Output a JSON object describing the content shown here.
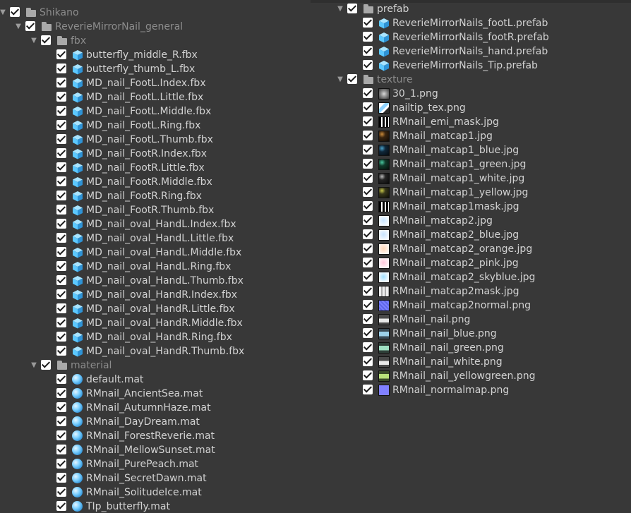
{
  "colors": {
    "background": "#383838",
    "text": "#d2d2d2",
    "dim_text": "#8c8c8c",
    "checkbox": "#ffffff",
    "cube_icon": "#5cc8ff",
    "material_icon": "#56b9f2"
  },
  "left_tree": [
    {
      "label": "Shikano",
      "level": 0,
      "kind": "folder",
      "arrow": true,
      "dim": true
    },
    {
      "label": "ReverieMirrorNail_general",
      "level": 1,
      "kind": "folder",
      "arrow": true,
      "dim": true
    },
    {
      "label": "fbx",
      "level": 2,
      "kind": "folder",
      "arrow": true,
      "dim": true
    },
    {
      "label": "butterfly_middle_R.fbx",
      "level": 3,
      "kind": "fbx"
    },
    {
      "label": "butterfly_thumb_L.fbx",
      "level": 3,
      "kind": "fbx"
    },
    {
      "label": "MD_nail_FootL.Index.fbx",
      "level": 3,
      "kind": "fbx"
    },
    {
      "label": "MD_nail_FootL.Little.fbx",
      "level": 3,
      "kind": "fbx"
    },
    {
      "label": "MD_nail_FootL.Middle.fbx",
      "level": 3,
      "kind": "fbx"
    },
    {
      "label": "MD_nail_FootL.Ring.fbx",
      "level": 3,
      "kind": "fbx"
    },
    {
      "label": "MD_nail_FootL.Thumb.fbx",
      "level": 3,
      "kind": "fbx"
    },
    {
      "label": "MD_nail_FootR.Index.fbx",
      "level": 3,
      "kind": "fbx"
    },
    {
      "label": "MD_nail_FootR.Little.fbx",
      "level": 3,
      "kind": "fbx"
    },
    {
      "label": "MD_nail_FootR.Middle.fbx",
      "level": 3,
      "kind": "fbx"
    },
    {
      "label": "MD_nail_FootR.Ring.fbx",
      "level": 3,
      "kind": "fbx"
    },
    {
      "label": "MD_nail_FootR.Thumb.fbx",
      "level": 3,
      "kind": "fbx"
    },
    {
      "label": "MD_nail_oval_HandL.Index.fbx",
      "level": 3,
      "kind": "fbx"
    },
    {
      "label": "MD_nail_oval_HandL.Little.fbx",
      "level": 3,
      "kind": "fbx"
    },
    {
      "label": "MD_nail_oval_HandL.Middle.fbx",
      "level": 3,
      "kind": "fbx"
    },
    {
      "label": "MD_nail_oval_HandL.Ring.fbx",
      "level": 3,
      "kind": "fbx"
    },
    {
      "label": "MD_nail_oval_HandL.Thumb.fbx",
      "level": 3,
      "kind": "fbx"
    },
    {
      "label": "MD_nail_oval_HandR.Index.fbx",
      "level": 3,
      "kind": "fbx"
    },
    {
      "label": "MD_nail_oval_HandR.Little.fbx",
      "level": 3,
      "kind": "fbx"
    },
    {
      "label": "MD_nail_oval_HandR.Middle.fbx",
      "level": 3,
      "kind": "fbx"
    },
    {
      "label": "MD_nail_oval_HandR.Ring.fbx",
      "level": 3,
      "kind": "fbx"
    },
    {
      "label": "MD_nail_oval_HandR.Thumb.fbx",
      "level": 3,
      "kind": "fbx"
    },
    {
      "label": "material",
      "level": 2,
      "kind": "folder",
      "arrow": true,
      "dim": true
    },
    {
      "label": "default.mat",
      "level": 3,
      "kind": "mat"
    },
    {
      "label": "RMnail_AncientSea.mat",
      "level": 3,
      "kind": "mat"
    },
    {
      "label": "RMnail_AutumnHaze.mat",
      "level": 3,
      "kind": "mat"
    },
    {
      "label": "RMnail_DayDream.mat",
      "level": 3,
      "kind": "mat"
    },
    {
      "label": "RMnail_ForestReverie.mat",
      "level": 3,
      "kind": "mat"
    },
    {
      "label": "RMnail_MellowSunset.mat",
      "level": 3,
      "kind": "mat"
    },
    {
      "label": "RMnail_PurePeach.mat",
      "level": 3,
      "kind": "mat"
    },
    {
      "label": "RMnail_SecretDawn.mat",
      "level": 3,
      "kind": "mat"
    },
    {
      "label": "RMnail_SolitudeIce.mat",
      "level": 3,
      "kind": "mat"
    },
    {
      "label": "TIp_butterfly.mat",
      "level": 3,
      "kind": "mat"
    }
  ],
  "right_tree": [
    {
      "label": "prefab",
      "level": 0,
      "kind": "folder",
      "arrow": true,
      "dim": false
    },
    {
      "label": "ReverieMirrorNails_footL.prefab",
      "level": 1,
      "kind": "prefab"
    },
    {
      "label": "ReverieMirrorNails_footR.prefab",
      "level": 1,
      "kind": "prefab"
    },
    {
      "label": "ReverieMirrorNails_hand.prefab",
      "level": 1,
      "kind": "prefab"
    },
    {
      "label": "ReverieMirrorNails_Tip.prefab",
      "level": 1,
      "kind": "prefab"
    },
    {
      "label": "texture",
      "level": 0,
      "kind": "folder",
      "arrow": true,
      "dim": true
    },
    {
      "label": "30_1.png",
      "level": 1,
      "kind": "tex",
      "tex": "butterfly-thumb"
    },
    {
      "label": "nailtip_tex.png",
      "level": 1,
      "kind": "tex",
      "tex": "nailtip-thumb"
    },
    {
      "label": "RMnail_emi_mask.jpg",
      "level": 1,
      "kind": "tex",
      "tex": "mask-thumb"
    },
    {
      "label": "RMnail_matcap1.jpg",
      "level": 1,
      "kind": "tex",
      "tex": "matcap-dark-orange-thumb"
    },
    {
      "label": "RMnail_matcap1_blue.jpg",
      "level": 1,
      "kind": "tex",
      "tex": "matcap-dark-blue-thumb"
    },
    {
      "label": "RMnail_matcap1_green.jpg",
      "level": 1,
      "kind": "tex",
      "tex": "matcap-dark-green-thumb"
    },
    {
      "label": "RMnail_matcap1_white.jpg",
      "level": 1,
      "kind": "tex",
      "tex": "matcap-dark-white-thumb"
    },
    {
      "label": "RMnail_matcap1_yellow.jpg",
      "level": 1,
      "kind": "tex",
      "tex": "matcap-dark-yellow-thumb"
    },
    {
      "label": "RMnail_matcap1mask.jpg",
      "level": 1,
      "kind": "tex",
      "tex": "mask-thumb"
    },
    {
      "label": "RMnail_matcap2.jpg",
      "level": 1,
      "kind": "tex",
      "tex": "matcap-light-blue-thumb"
    },
    {
      "label": "RMnail_matcap2_blue.jpg",
      "level": 1,
      "kind": "tex",
      "tex": "matcap-light-blue-thumb"
    },
    {
      "label": "RMnail_matcap2_orange.jpg",
      "level": 1,
      "kind": "tex",
      "tex": "matcap-light-orange-thumb"
    },
    {
      "label": "RMnail_matcap2_pink.jpg",
      "level": 1,
      "kind": "tex",
      "tex": "matcap-light-pink-thumb"
    },
    {
      "label": "RMnail_matcap2_skyblue.jpg",
      "level": 1,
      "kind": "tex",
      "tex": "matcap-light-sky-thumb"
    },
    {
      "label": "RMnail_matcap2mask.jpg",
      "level": 1,
      "kind": "tex",
      "tex": "mask-light-thumb"
    },
    {
      "label": "RMnail_matcap2normal.png",
      "level": 1,
      "kind": "tex",
      "tex": "normal-thumb"
    },
    {
      "label": "RMnail_nail.png",
      "level": 1,
      "kind": "tex",
      "tex": "nail-white-thumb"
    },
    {
      "label": "RMnail_nail_blue.png",
      "level": 1,
      "kind": "tex",
      "tex": "nail-blue-thumb"
    },
    {
      "label": "RMnail_nail_green.png",
      "level": 1,
      "kind": "tex",
      "tex": "nail-green-thumb"
    },
    {
      "label": "RMnail_nail_white.png",
      "level": 1,
      "kind": "tex",
      "tex": "nail-white-thumb"
    },
    {
      "label": "RMnail_nail_yellowgreen.png",
      "level": 1,
      "kind": "tex",
      "tex": "nail-yellowgreen-thumb"
    },
    {
      "label": "RMnail_normalmap.png",
      "level": 1,
      "kind": "tex",
      "tex": "normalmap-thumb"
    }
  ]
}
